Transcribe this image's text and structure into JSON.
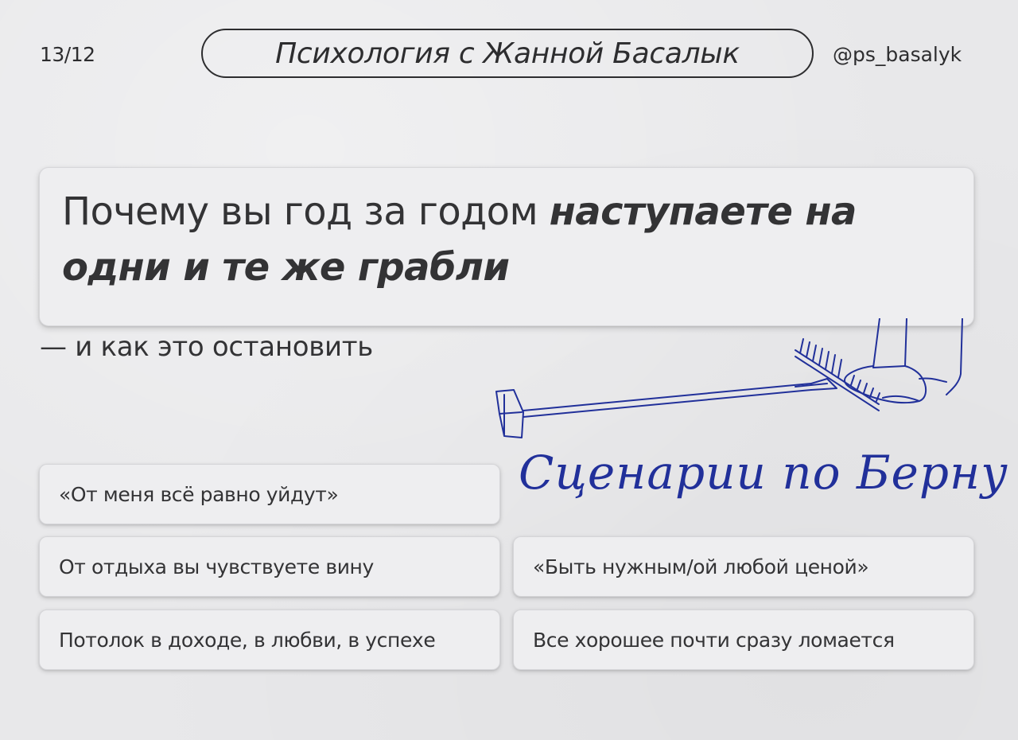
{
  "header": {
    "page_number": "13/12",
    "brand_title": "Психология с Жанной Басалык",
    "handle": "@ps_basalyk"
  },
  "headline": {
    "regular_part": "Почему вы год за годом ",
    "emphasis_part": "наступаете на одни и те же грабли"
  },
  "subheadline": "— и как это остановить",
  "illustration": {
    "icon": "foot-stepping-on-rake-illustration",
    "color": "#21309a"
  },
  "berne_title": "Сценарии по Берну",
  "scripts": [
    "«От меня всё равно уйдут»",
    "От отдыха вы чувствуете вину",
    "«Быть нужным/ой любой ценой»",
    "Потолок в доходе, в любви, в успехе",
    "Все хорошее почти сразу ломается"
  ],
  "colors": {
    "background": "#e8e8ea",
    "text": "#2d2d2f",
    "accent_blue": "#21309a"
  }
}
